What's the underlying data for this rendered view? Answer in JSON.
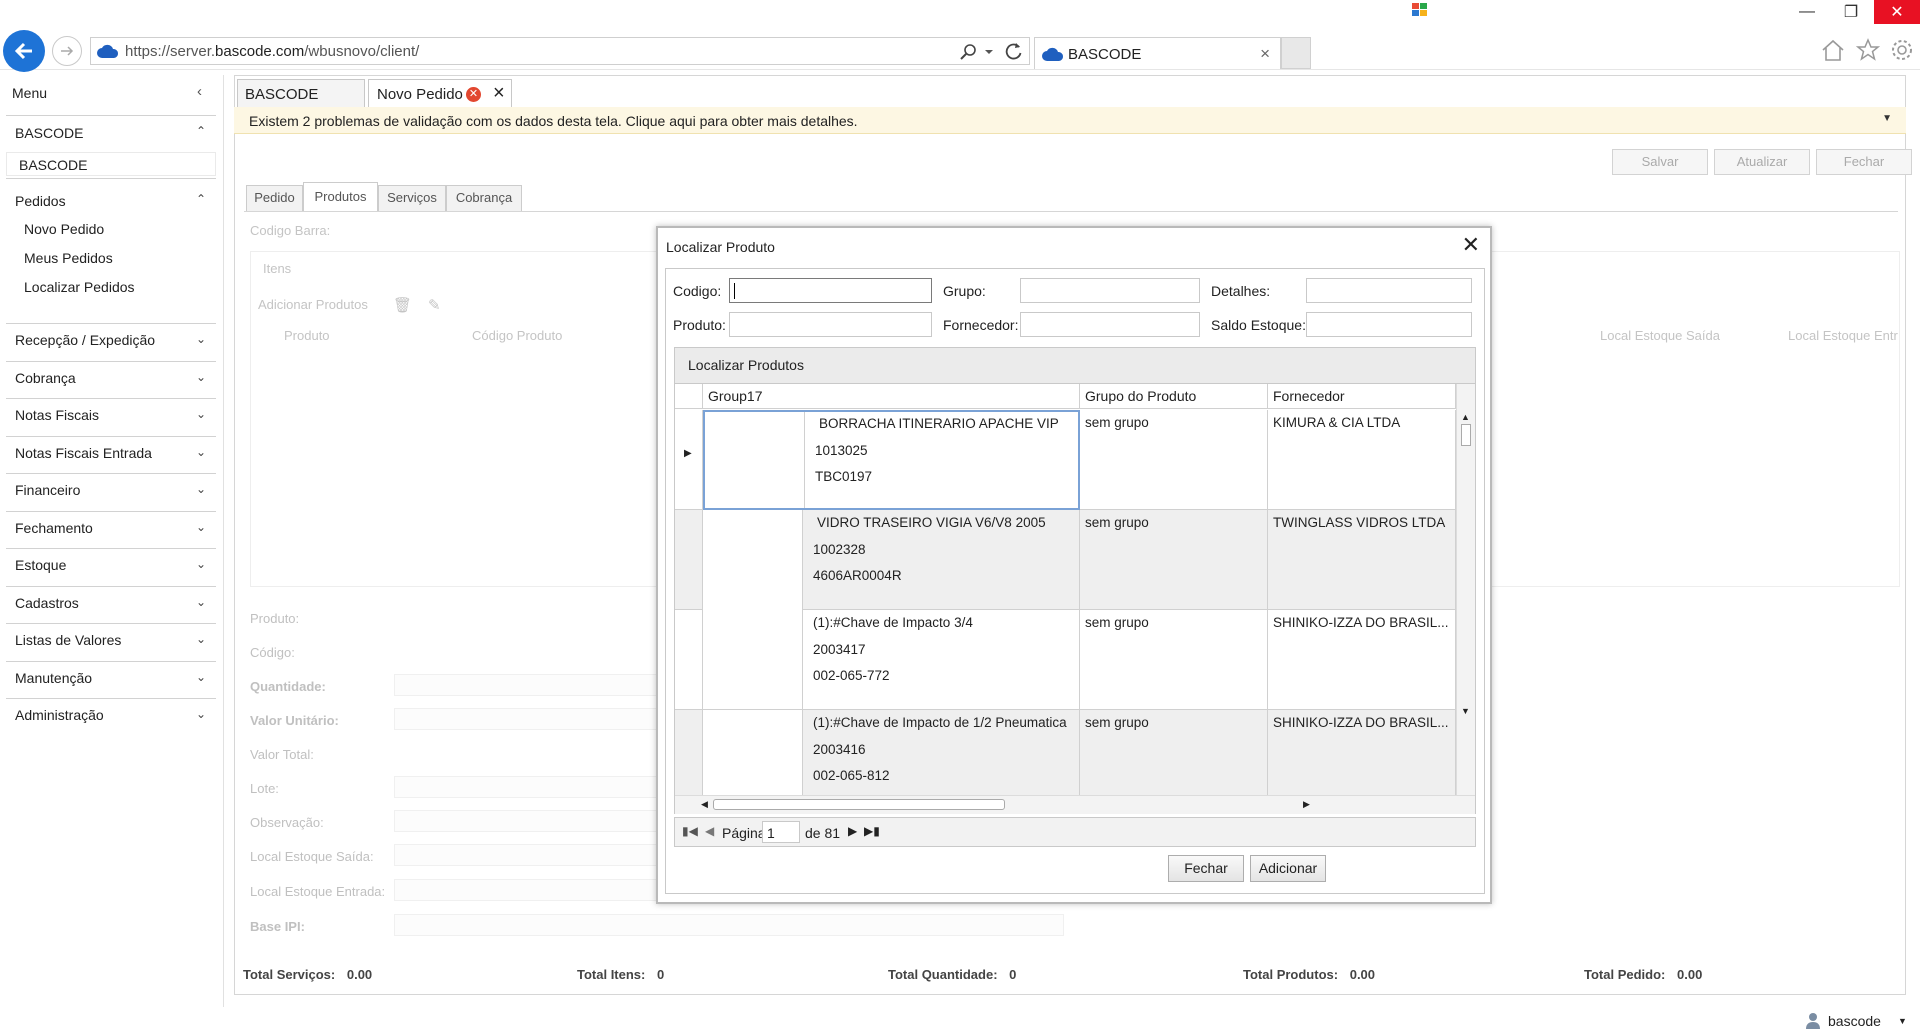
{
  "browser": {
    "url_prefix": "https://server.",
    "url_domain": "bascode.com",
    "url_path": "/wbusnovo/client/",
    "tab_title": "BASCODE",
    "close_glyph": "×"
  },
  "sidebar": {
    "title": "Menu",
    "sections": [
      {
        "label": "BASCODE",
        "expanded": true,
        "items": [
          "BASCODE"
        ]
      },
      {
        "label": "Pedidos",
        "expanded": true,
        "items": [
          "Novo Pedido",
          "Meus Pedidos",
          "Localizar Pedidos"
        ]
      },
      {
        "label": "Recepção / Expedição"
      },
      {
        "label": "Cobrança"
      },
      {
        "label": "Notas Fiscais"
      },
      {
        "label": "Notas Fiscais Entrada"
      },
      {
        "label": "Financeiro"
      },
      {
        "label": "Fechamento"
      },
      {
        "label": "Estoque"
      },
      {
        "label": "Cadastros"
      },
      {
        "label": "Listas de Valores"
      },
      {
        "label": "Manutenção"
      },
      {
        "label": "Administração"
      }
    ]
  },
  "page_tabs": [
    "BASCODE",
    "Novo Pedido"
  ],
  "warning": "Existem 2 problemas de validação com os dados desta tela. Clique aqui para obter mais detalhes.",
  "toolbar": {
    "save": "Salvar",
    "update": "Atualizar",
    "close": "Fechar"
  },
  "inner_tabs": [
    "Pedido",
    "Produtos",
    "Serviços",
    "Cobrança"
  ],
  "background_form": {
    "barcode_label": "Codigo Barra:",
    "items_label": "Itens",
    "add_products": "Adicionar Produtos",
    "col_produto": "Produto",
    "col_codigo": "Código Produto",
    "col_local_saida": "Local Estoque Saída",
    "col_local_entrada": "Local Estoque Entr",
    "fields": [
      "Produto:",
      "Código:",
      "Quantidade:",
      "Valor Unitário:",
      "Valor Total:",
      "Lote:",
      "Observação:",
      "Local Estoque Saída:",
      "Local Estoque Entrada:",
      "Base IPI:"
    ]
  },
  "totals": [
    {
      "label": "Total Serviços:",
      "value": "0.00"
    },
    {
      "label": "Total Itens:",
      "value": "0"
    },
    {
      "label": "Total Quantidade:",
      "value": "0"
    },
    {
      "label": "Total Produtos:",
      "value": "0.00"
    },
    {
      "label": "Total Pedido:",
      "value": "0.00"
    }
  ],
  "dialog": {
    "title": "Localizar Produto",
    "filters": {
      "codigo": "Codigo:",
      "grupo": "Grupo:",
      "detalhes": "Detalhes:",
      "produto": "Produto:",
      "fornecedor": "Fornecedor:",
      "saldo": "Saldo Estoque:"
    },
    "grid_title": "Localizar Produtos",
    "columns": [
      "Group17",
      "Grupo do Produto",
      "Fornecedor"
    ],
    "rows": [
      {
        "name": "BORRACHA ITINERARIO APACHE VIP",
        "code": "1013025",
        "ref": "TBC0197",
        "group": "sem grupo",
        "supplier": "KIMURA & CIA LTDA",
        "selected": true
      },
      {
        "name": "VIDRO TRASEIRO VIGIA V6/V8 2005",
        "code": "1002328",
        "ref": "4606AR0004R",
        "group": "sem grupo",
        "supplier": "TWINGLASS VIDROS LTDA"
      },
      {
        "name": "(1):#Chave de Impacto 3/4",
        "code": "2003417",
        "ref": "002-065-772",
        "group": "sem grupo",
        "supplier": "SHINIKO-IZZA DO BRASIL..."
      },
      {
        "name": "(1):#Chave de Impacto de 1/2 Pneumatica",
        "code": "2003416",
        "ref": "002-065-812",
        "group": "sem grupo",
        "supplier": "SHINIKO-IZZA DO BRASIL..."
      }
    ],
    "pager": {
      "page_label": "Página",
      "page": "1",
      "of_label": "de 81"
    },
    "buttons": {
      "close": "Fechar",
      "add": "Adicionar"
    }
  },
  "status": {
    "user": "bascode"
  },
  "colors": {
    "accent": "#1e73d6",
    "warning_bg": "#fdf7e3",
    "close_red": "#e81123"
  }
}
